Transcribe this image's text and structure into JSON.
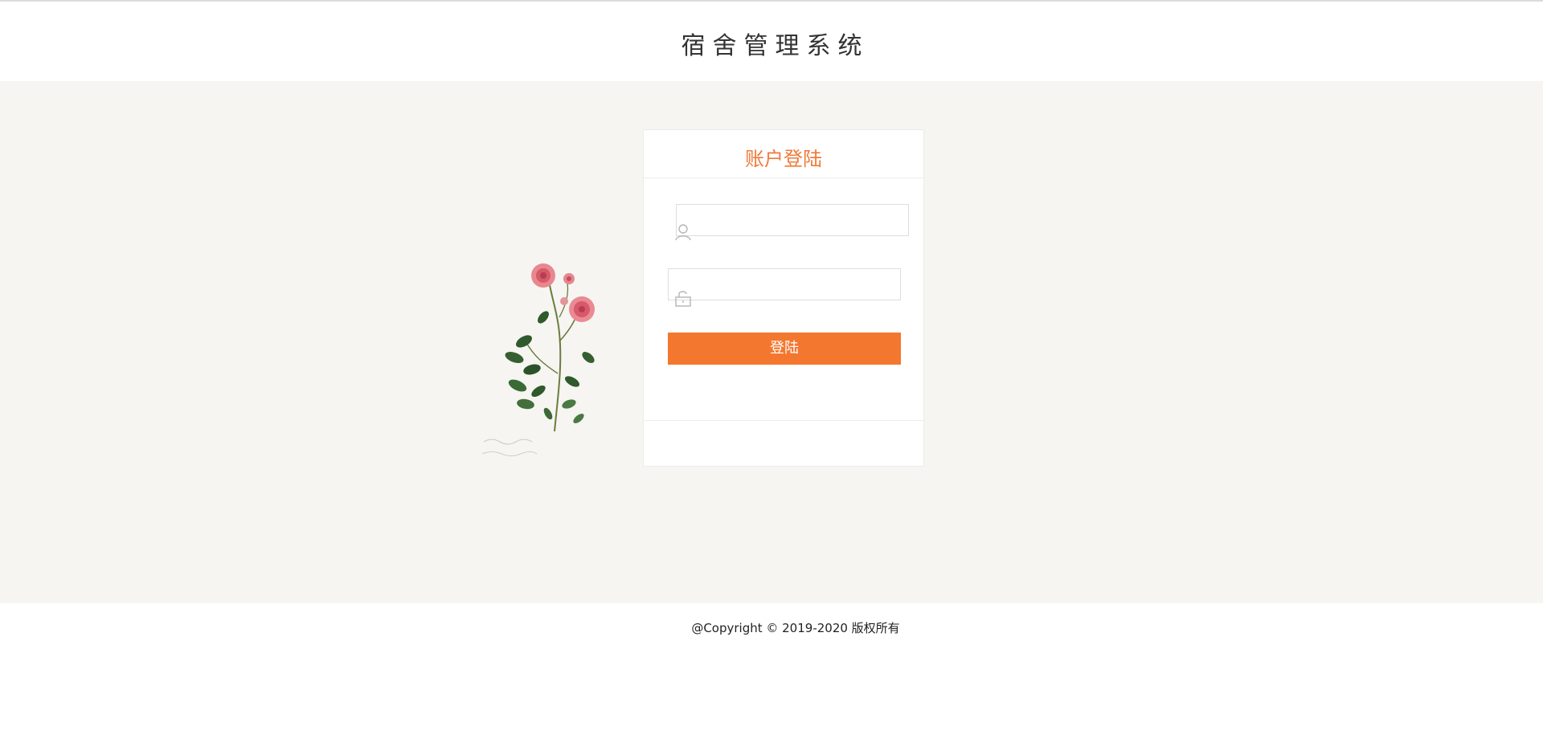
{
  "header": {
    "title": "宿舍管理系统"
  },
  "login": {
    "title": "账户登陆",
    "username": {
      "value": "",
      "placeholder": "",
      "icon": "user-icon"
    },
    "password": {
      "value": "",
      "placeholder": "",
      "icon": "lock-icon"
    },
    "button_label": "登陆"
  },
  "footer": {
    "copyright": "@Copyright © 2019-2020 版权所有"
  },
  "colors": {
    "accent": "#f4772f",
    "title_accent": "#f07a3a",
    "background": "#f6f5f2"
  }
}
